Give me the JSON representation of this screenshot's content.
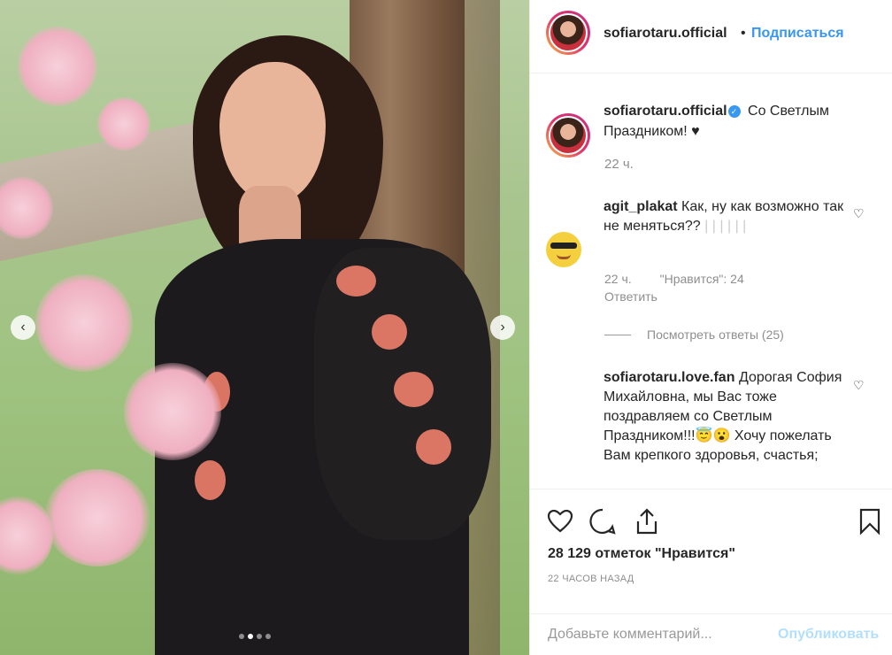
{
  "header": {
    "username": "sofiarotaru.official",
    "separator": "•",
    "follow_label": "Подписаться"
  },
  "photo": {
    "prev_icon": "‹",
    "next_icon": "›",
    "slide_count": 4,
    "active_slide": 2
  },
  "caption": {
    "username": "sofiarotaru.official",
    "verified_icon": "✓",
    "text": "Со Светлым Праздником! ♥",
    "time": "22 ч."
  },
  "comments": [
    {
      "username": "agit_plakat",
      "text": "Как, ну как возможно так не меняться??",
      "faded_marks": "| | | | | |",
      "time": "22 ч.",
      "likes": "\"Нравится\": 24",
      "reply_label": "Ответить",
      "view_replies": "Посмотреть ответы (25)"
    },
    {
      "username": "sofiarotaru.love.fan",
      "text": "Дорогая София Михайловна, мы Вас тоже поздравляем со Светлым Праздником!!!😇😮 Хочу пожелать Вам крепкого здоровья, счастья;"
    }
  ],
  "heart_icon": "♡",
  "actions": {
    "likes_text": "28 129 отметок \"Нравится\"",
    "timestamp": "22 ЧАСОВ НАЗАД"
  },
  "add_comment": {
    "placeholder": "Добавьте комментарий...",
    "post_label": "Опубликовать"
  },
  "colors": {
    "accent": "#3897f0",
    "post_disabled": "#b2dffc",
    "muted": "#8e8e8e"
  }
}
